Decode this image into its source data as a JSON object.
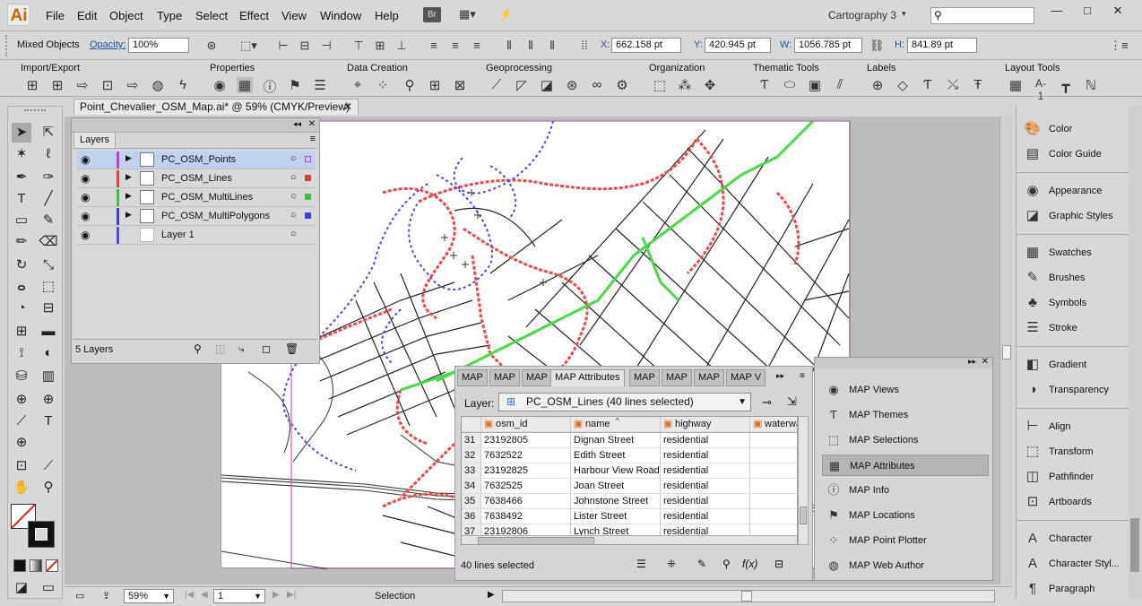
{
  "app": {
    "logo": "Ai",
    "bridge": "Br",
    "workspace": "Cartography 3"
  },
  "menu": [
    "File",
    "Edit",
    "Object",
    "Type",
    "Select",
    "Effect",
    "View",
    "Window",
    "Help"
  ],
  "control": {
    "selection_label": "Mixed Objects",
    "opacity_label": "Opacity:",
    "opacity_value": "100%",
    "x_label": "X:",
    "x_value": "662.158 pt",
    "y_label": "Y:",
    "y_value": "420.945 pt",
    "w_label": "W:",
    "w_value": "1056.785 pt",
    "h_label": "H:",
    "h_value": "841.89 pt"
  },
  "mapbar": {
    "groups": [
      "Import/Export",
      "Properties",
      "Data Creation",
      "Geoprocessing",
      "Organization",
      "Thematic Tools",
      "Labels",
      "Layout Tools"
    ]
  },
  "document": {
    "tab": "Point_Chevalier_OSM_Map.ai* @ 59% (CMYK/Preview)"
  },
  "layers": {
    "tab": "Layers",
    "rows": [
      {
        "name": "PC_OSM_Points",
        "color": "#c040c0",
        "selected": true
      },
      {
        "name": "PC_OSM_Lines",
        "color": "#e04040",
        "selected": false
      },
      {
        "name": "PC_OSM_MultiLines",
        "color": "#40c040",
        "selected": false
      },
      {
        "name": "PC_OSM_MultiPolygons",
        "color": "#4040e0",
        "selected": false
      },
      {
        "name": "Layer 1",
        "color": "#5050d0",
        "selected": false
      }
    ],
    "footer": "5 Layers"
  },
  "attributes": {
    "tabs": [
      "MAP",
      "MAP",
      "MAP",
      "MAP Attributes",
      "MAP",
      "MAP",
      "MAP",
      "MAP V"
    ],
    "layer_label": "Layer:",
    "layer_value": "PC_OSM_Lines (40 lines selected)",
    "columns": [
      "osm_id",
      "name",
      "highway",
      "waterwa"
    ],
    "rows": [
      {
        "n": "31",
        "id": "23192805",
        "name": "Dignan Street",
        "hw": "residential"
      },
      {
        "n": "32",
        "id": "7632522",
        "name": "Edith Street",
        "hw": "residential"
      },
      {
        "n": "33",
        "id": "23192825",
        "name": "Harbour View Road",
        "hw": "residential"
      },
      {
        "n": "34",
        "id": "7632525",
        "name": "Joan Street",
        "hw": "residential"
      },
      {
        "n": "35",
        "id": "7638466",
        "name": "Johnstone Street",
        "hw": "residential"
      },
      {
        "n": "36",
        "id": "7638492",
        "name": "Lister Street",
        "hw": "residential"
      },
      {
        "n": "37",
        "id": "23192806",
        "name": "Lynch Street",
        "hw": "residential"
      }
    ],
    "footer": "40 lines selected"
  },
  "map_panel": [
    {
      "label": "MAP Views",
      "icon": "globe-icon"
    },
    {
      "label": "MAP Themes",
      "icon": "theme-icon"
    },
    {
      "label": "MAP Selections",
      "icon": "selection-icon"
    },
    {
      "label": "MAP Attributes",
      "icon": "table-icon",
      "active": true
    },
    {
      "label": "MAP Info",
      "icon": "info-icon"
    },
    {
      "label": "MAP Locations",
      "icon": "pin-icon"
    },
    {
      "label": "MAP Point Plotter",
      "icon": "plotter-icon"
    },
    {
      "label": "MAP Web Author",
      "icon": "web-icon"
    }
  ],
  "right_dock": [
    "Color",
    "Color Guide",
    "Appearance",
    "Graphic Styles",
    "Swatches",
    "Brushes",
    "Symbols",
    "Stroke",
    "Gradient",
    "Transparency",
    "Align",
    "Transform",
    "Pathfinder",
    "Artboards",
    "Character",
    "Character Styl...",
    "Paragraph"
  ],
  "status": {
    "zoom": "59%",
    "page": "1",
    "tool": "Selection"
  },
  "colors": {
    "accent": "#c86700",
    "red": "#f04848",
    "blue": "#4a4ae0",
    "green": "#44dd44"
  }
}
